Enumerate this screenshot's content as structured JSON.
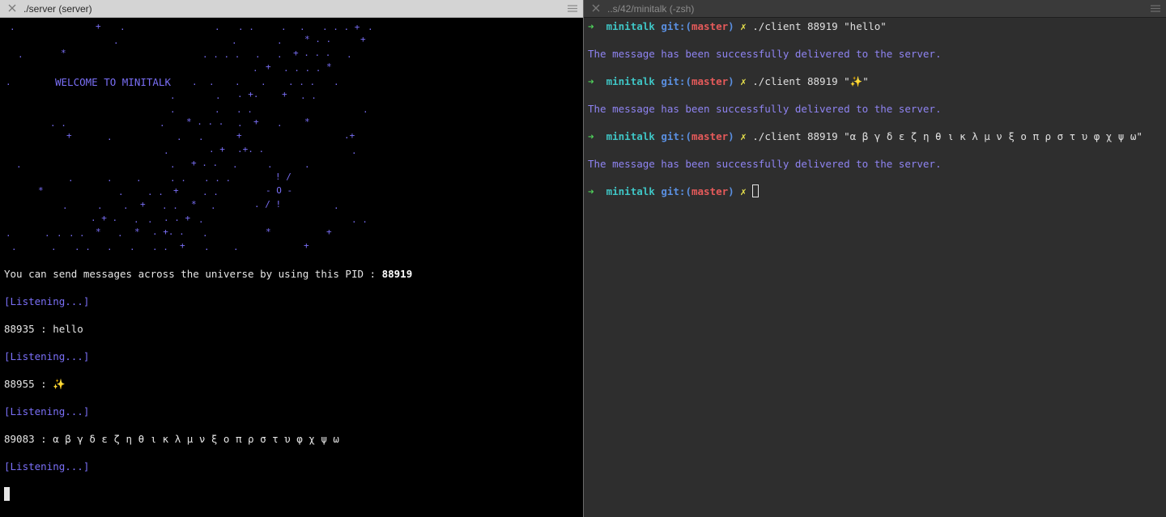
{
  "left": {
    "title": "./server (server)",
    "banner": "WELCOME TO MINITALK",
    "pid_prefix": "You can send messages across the universe by using this PID : ",
    "pid": "88919",
    "listening": "[Listening...]",
    "messages": [
      "88935 : hello",
      "88955 : ✨",
      "89083 : α β γ δ ε ζ η θ ι κ λ μ ν ξ ο π ρ σ τ υ φ χ ψ ω"
    ]
  },
  "right": {
    "title": "..s/42/minitalk (-zsh)",
    "prompt": {
      "arrow": "➜",
      "dir": "minitalk",
      "git_open": "git:(",
      "branch": "master",
      "git_close": ")",
      "dirty": "✗"
    },
    "commands": [
      "./client 88919 \"hello\"",
      "./client 88919 \"✨\"",
      "./client 88919 \"α β γ δ ε ζ η θ ι κ λ μ ν ξ ο π ρ σ τ υ φ χ ψ ω\""
    ],
    "response": "The message has been successfully delivered to the server."
  },
  "icons": {
    "close": "close-icon",
    "menu": "hamburger-menu-icon"
  },
  "colors": {
    "accent_blue": "#7a6ff7",
    "prompt_green": "#4fd05a",
    "dir_cyan": "#3fc5c5",
    "branch_red": "#e55a5a",
    "dirty_yellow": "#e8e24c"
  }
}
